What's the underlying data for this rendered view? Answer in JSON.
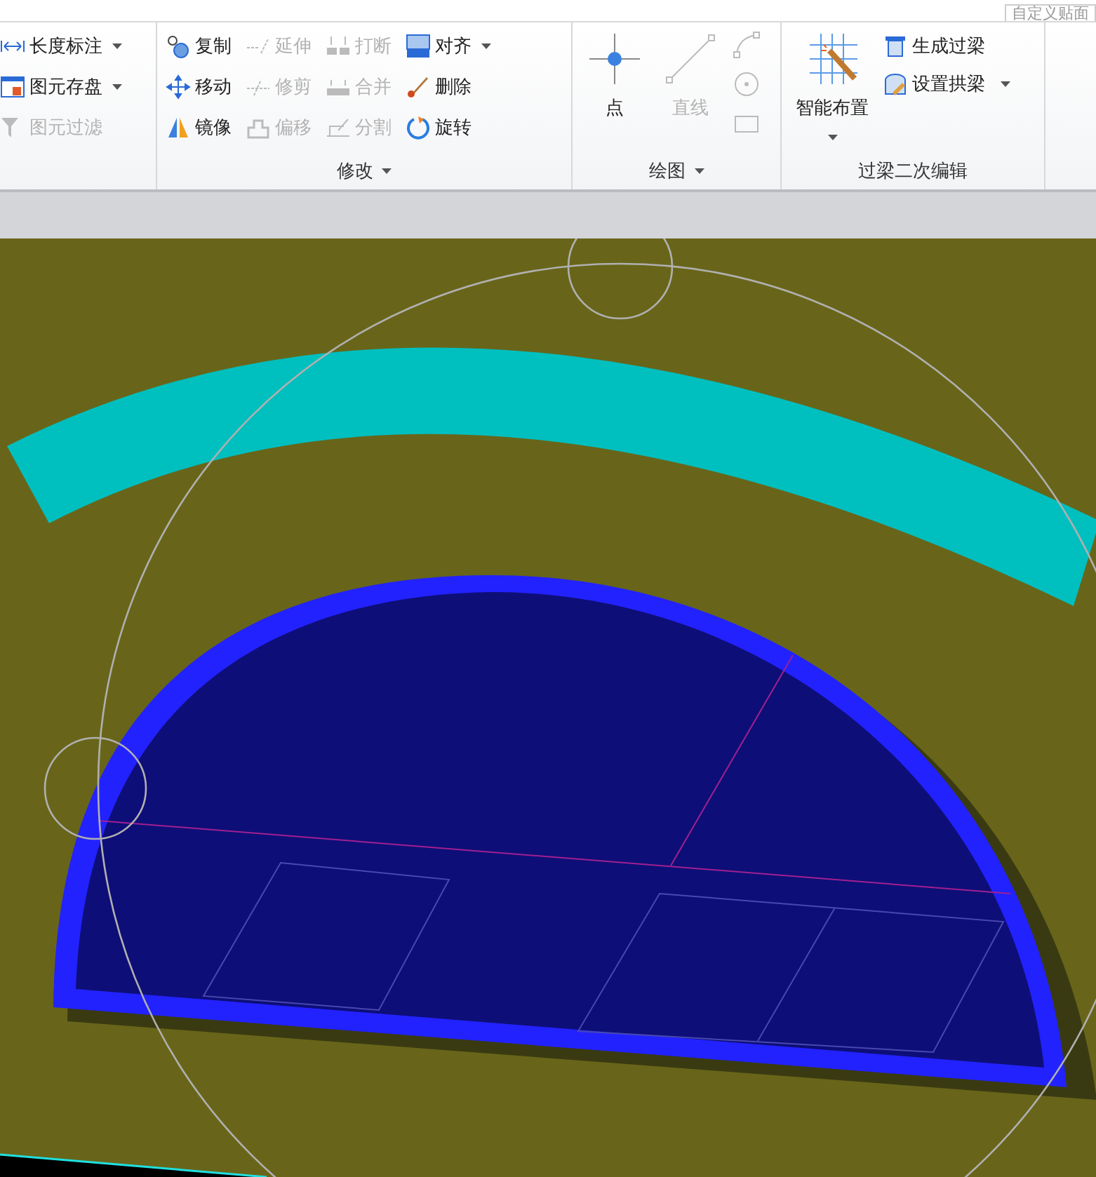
{
  "top_strip": {
    "text": "自定义贴面"
  },
  "ribbon": {
    "groups": [
      {
        "items": [
          {
            "kind": "small",
            "label": "长度标注",
            "dropdown": true,
            "disabled": false
          },
          {
            "kind": "small",
            "label": "图元存盘",
            "dropdown": true,
            "disabled": false
          },
          {
            "kind": "small",
            "label": "图元过滤",
            "dropdown": false,
            "disabled": true
          }
        ]
      },
      {
        "label": "修改",
        "items": [
          {
            "kind": "small",
            "label": "复制",
            "dropdown": false,
            "disabled": false
          },
          {
            "kind": "small",
            "label": "延伸",
            "dropdown": false,
            "disabled": true
          },
          {
            "kind": "small",
            "label": "打断",
            "dropdown": false,
            "disabled": true
          },
          {
            "kind": "small",
            "label": "对齐",
            "dropdown": true,
            "disabled": false
          },
          {
            "kind": "small",
            "label": "移动",
            "dropdown": false,
            "disabled": false
          },
          {
            "kind": "small",
            "label": "修剪",
            "dropdown": false,
            "disabled": true
          },
          {
            "kind": "small",
            "label": "合并",
            "dropdown": false,
            "disabled": true
          },
          {
            "kind": "small",
            "label": "删除",
            "dropdown": false,
            "disabled": false
          },
          {
            "kind": "small",
            "label": "镜像",
            "dropdown": false,
            "disabled": false
          },
          {
            "kind": "small",
            "label": "偏移",
            "dropdown": false,
            "disabled": true
          },
          {
            "kind": "small",
            "label": "分割",
            "dropdown": false,
            "disabled": true
          },
          {
            "kind": "small",
            "label": "旋转",
            "dropdown": false,
            "disabled": false
          }
        ]
      },
      {
        "label": "绘图",
        "items": [
          {
            "kind": "large",
            "label": "点",
            "dropdown": false,
            "disabled": false
          },
          {
            "kind": "large",
            "label": "直线",
            "dropdown": false,
            "disabled": true
          },
          {
            "kind": "icons",
            "disabled": true
          }
        ]
      },
      {
        "label": "过梁二次编辑",
        "items": [
          {
            "kind": "large",
            "label": "智能布置",
            "dropdown": true,
            "disabled": false
          },
          {
            "kind": "stack",
            "children": [
              {
                "label": "生成过梁",
                "dropdown": false,
                "disabled": false
              },
              {
                "label": "设置拱梁",
                "dropdown": true,
                "disabled": false
              }
            ]
          }
        ]
      }
    ]
  }
}
